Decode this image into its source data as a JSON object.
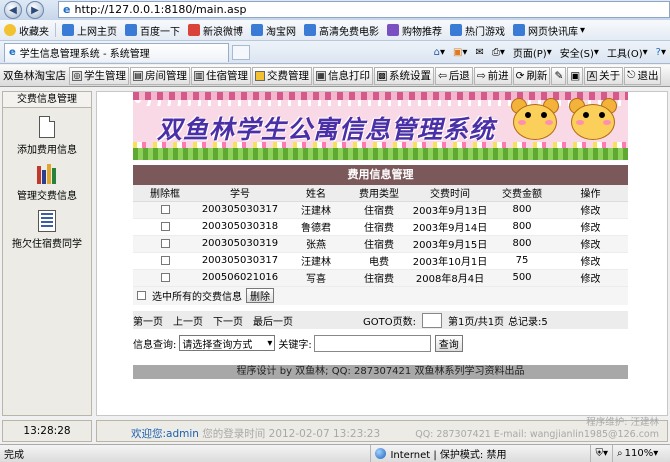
{
  "browser": {
    "url": "http://127.0.0.1:8180/main.asp",
    "tab_title": "学生信息管理系统 - 系统管理",
    "favorites_label": "收藏夹",
    "bookmarks": [
      "上网主页",
      "百度一下",
      "新浪微博",
      "淘宝网",
      "高清免费电影",
      "购物推荐",
      "热门游戏",
      "网页快讯库"
    ],
    "tools": {
      "page": "页面(P)",
      "safety": "安全(S)",
      "tools": "工具(O)"
    }
  },
  "app_toolbar": {
    "shop": "双鱼林淘宝店",
    "items": [
      "学生管理",
      "房间管理",
      "住宿管理",
      "交费管理",
      "信息打印",
      "系统设置"
    ],
    "back": "后退",
    "forward": "前进",
    "refresh": "刷新",
    "about": "关于",
    "exit": "退出"
  },
  "sidebar": {
    "header": "交费信息管理",
    "items": [
      "添加费用信息",
      "管理交费信息",
      "拖欠住宿费同学"
    ]
  },
  "banner": {
    "title": "双鱼林学生公寓信息管理系统"
  },
  "fee_panel": {
    "title": "费用信息管理",
    "columns": [
      "删除框",
      "学号",
      "姓名",
      "费用类型",
      "交费时间",
      "交费金额",
      "操作"
    ],
    "rows": [
      {
        "id": "200305030317",
        "name": "汪建林",
        "type": "住宿费",
        "date": "2003年9月13日",
        "amount": "800",
        "action": "修改"
      },
      {
        "id": "200305030318",
        "name": "鲁德君",
        "type": "住宿费",
        "date": "2003年9月14日",
        "amount": "800",
        "action": "修改"
      },
      {
        "id": "200305030319",
        "name": "张燕",
        "type": "住宿费",
        "date": "2003年9月15日",
        "amount": "800",
        "action": "修改"
      },
      {
        "id": "200305030317",
        "name": "汪建林",
        "type": "电费",
        "date": "2003年10月1日",
        "amount": "75",
        "action": "修改"
      },
      {
        "id": "200506021016",
        "name": "写喜",
        "type": "住宿费",
        "date": "2008年8月4日",
        "amount": "500",
        "action": "修改"
      }
    ],
    "select_all_label": "选中所有的交费信息",
    "delete_label": "删除"
  },
  "pager": {
    "first": "第一页",
    "prev": "上一页",
    "next": "下一页",
    "last": "最后一页",
    "goto_label": "GOTO页数:",
    "page_info": "第1页/共1页",
    "records": "总记录:5"
  },
  "query": {
    "label": "信息查询:",
    "select_value": "请选择查询方式",
    "keyword_label": "关键字:",
    "button": "查询"
  },
  "footer_strip": "程序设计 by 双鱼林; QQ: 287307421 双鱼林系列学习资料出品",
  "clock": "13:28:28",
  "welcome": {
    "prefix": "欢迎您:",
    "user": "admin",
    "last_login": "您的登录时间 2012-02-07 13:23:23"
  },
  "maintainer": {
    "line1": "程序维护: 汪建林",
    "line2": "QQ: 287307421 E-mail: wangjianlin1985@126.com"
  },
  "status_bar": {
    "left": "完成",
    "zone": "Internet | 保护模式: 禁用",
    "zoom": "110%"
  }
}
